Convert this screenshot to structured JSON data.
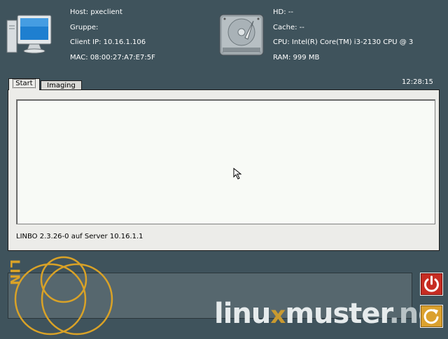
{
  "host_info": {
    "host": "Host: pxeclient",
    "group": "Gruppe:",
    "client_ip": "Client IP: 10.16.1.106",
    "mac": "MAC: 08:00:27:A7:E7:5F"
  },
  "hardware_info": {
    "hd": "HD: --",
    "cache": "Cache: --",
    "cpu": "CPU: Intel(R) Core(TM) i3-2130 CPU @ 3",
    "ram": "RAM: 999 MB"
  },
  "tabs": [
    {
      "label": "Start",
      "active": true
    },
    {
      "label": "Imaging",
      "active": false
    }
  ],
  "clock": "12:28:15",
  "status": "LINBO 2.3.26-0 auf Server 10.16.1.1",
  "branding": {
    "vertical_text": "LIN",
    "logo_start": "linu",
    "logo_mid": "x",
    "logo_end": "muster",
    "logo_tail": ".ne"
  },
  "buttons": {
    "power": "power-icon",
    "reboot": "reboot-icon"
  },
  "colors": {
    "background": "#3f535c",
    "accent_gold": "#d9a227",
    "power_red": "#c72d23",
    "reboot_orange": "#dba12e"
  }
}
